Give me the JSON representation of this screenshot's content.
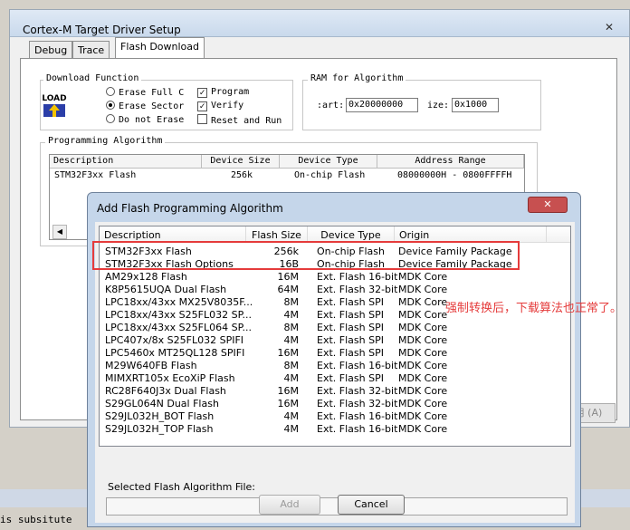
{
  "background_window": {
    "title": "Cortex-M Target Driver Setup",
    "close_glyph": "✕",
    "tabs": [
      {
        "label": "Debug",
        "active": false
      },
      {
        "label": "Trace",
        "active": false
      },
      {
        "label": "Flash Download",
        "active": true
      }
    ],
    "download_function": {
      "legend": "Download Function",
      "icon_text": "LOAD",
      "radios": [
        {
          "label": "Erase Full C",
          "selected": false
        },
        {
          "label": "Erase Sector",
          "selected": true
        },
        {
          "label": "Do not Erase",
          "selected": false
        }
      ],
      "checks": [
        {
          "label": "Program",
          "checked": true
        },
        {
          "label": "Verify",
          "checked": true
        },
        {
          "label": "Reset and Run",
          "checked": false
        }
      ]
    },
    "ram_for_algorithm": {
      "legend": "RAM for Algorithm",
      "start_label": ":art:",
      "start_value": "0x20000000",
      "size_label": "ize:",
      "size_value": "0x1000"
    },
    "programming_algorithm": {
      "legend": "Programming Algorithm",
      "columns": [
        "Description",
        "Device Size",
        "Device Type",
        "Address Range"
      ],
      "rows": [
        [
          "STM32F3xx Flash",
          "256k",
          "On-chip Flash",
          "08000000H - 0800FFFFH"
        ]
      ]
    },
    "apply_label": "用 (A)"
  },
  "dialog": {
    "title": "Add Flash Programming Algorithm",
    "close_glyph": "✕",
    "columns": [
      "Description",
      "Flash Size",
      "Device Type",
      "Origin"
    ],
    "rows": [
      {
        "description": "STM32F3xx Flash",
        "size": "256k",
        "type": "On-chip Flash",
        "origin": "Device Family Package"
      },
      {
        "description": "STM32F3xx Flash Options",
        "size": "16B",
        "type": "On-chip Flash",
        "origin": "Device Family Package"
      },
      {
        "description": "AM29x128 Flash",
        "size": "16M",
        "type": "Ext. Flash 16-bit",
        "origin": "MDK Core"
      },
      {
        "description": "K8P5615UQA Dual Flash",
        "size": "64M",
        "type": "Ext. Flash 32-bit",
        "origin": "MDK Core"
      },
      {
        "description": "LPC18xx/43xx MX25V8035F...",
        "size": "8M",
        "type": "Ext. Flash SPI",
        "origin": "MDK Core"
      },
      {
        "description": "LPC18xx/43xx S25FL032 SP...",
        "size": "4M",
        "type": "Ext. Flash SPI",
        "origin": "MDK Core"
      },
      {
        "description": "LPC18xx/43xx S25FL064 SP...",
        "size": "8M",
        "type": "Ext. Flash SPI",
        "origin": "MDK Core"
      },
      {
        "description": "LPC407x/8x S25FL032 SPIFI",
        "size": "4M",
        "type": "Ext. Flash SPI",
        "origin": "MDK Core"
      },
      {
        "description": "LPC5460x MT25QL128 SPIFI",
        "size": "16M",
        "type": "Ext. Flash SPI",
        "origin": "MDK Core"
      },
      {
        "description": "M29W640FB Flash",
        "size": "8M",
        "type": "Ext. Flash 16-bit",
        "origin": "MDK Core"
      },
      {
        "description": "MIMXRT105x EcoXiP Flash",
        "size": "4M",
        "type": "Ext. Flash SPI",
        "origin": "MDK Core"
      },
      {
        "description": "RC28F640J3x Dual Flash",
        "size": "16M",
        "type": "Ext. Flash 32-bit",
        "origin": "MDK Core"
      },
      {
        "description": "S29GL064N Dual Flash",
        "size": "16M",
        "type": "Ext. Flash 32-bit",
        "origin": "MDK Core"
      },
      {
        "description": "S29JL032H_BOT Flash",
        "size": "4M",
        "type": "Ext. Flash 16-bit",
        "origin": "MDK Core"
      },
      {
        "description": "S29JL032H_TOP Flash",
        "size": "4M",
        "type": "Ext. Flash 16-bit",
        "origin": "MDK Core"
      }
    ],
    "selected_label": "Selected Flash Algorithm File:",
    "selected_value": "",
    "add_label": "Add",
    "cancel_label": "Cancel"
  },
  "annotation": "强制转换后，下载算法也正常了。",
  "bottom_text": "is subsitute",
  "colors": {
    "highlight": "#e53b3b",
    "dialog_frame": "#c5d6ea",
    "close_button": "#c75050"
  }
}
